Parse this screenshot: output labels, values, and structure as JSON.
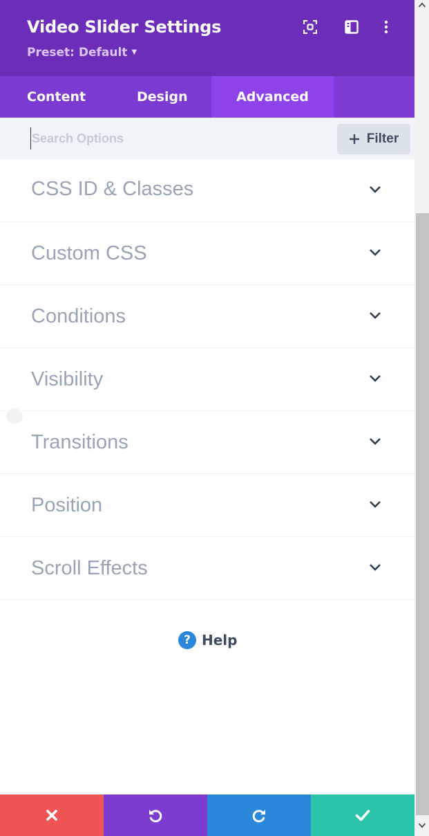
{
  "header": {
    "title": "Video Slider Settings",
    "preset": "Preset: Default",
    "icons": [
      "screenshot-mode-icon",
      "sidebar-layout-icon",
      "more-options-icon"
    ]
  },
  "tabs": [
    {
      "label": "Content",
      "active": false
    },
    {
      "label": "Design",
      "active": false
    },
    {
      "label": "Advanced",
      "active": true
    }
  ],
  "search": {
    "placeholder": "Search Options",
    "value": "",
    "filter_label": "Filter"
  },
  "sections": [
    {
      "label": "CSS ID & Classes"
    },
    {
      "label": "Custom CSS"
    },
    {
      "label": "Conditions"
    },
    {
      "label": "Visibility"
    },
    {
      "label": "Transitions"
    },
    {
      "label": "Position"
    },
    {
      "label": "Scroll Effects"
    }
  ],
  "help": {
    "label": "Help",
    "icon": "question-icon"
  },
  "footer": {
    "buttons": [
      {
        "name": "discard",
        "icon": "close-icon",
        "color": "#ef5555"
      },
      {
        "name": "undo",
        "icon": "undo-icon",
        "color": "#7e3bd0"
      },
      {
        "name": "redo",
        "icon": "redo-icon",
        "color": "#2b87da"
      },
      {
        "name": "save",
        "icon": "check-icon",
        "color": "#29c4a9"
      }
    ]
  },
  "colors": {
    "header_bg": "#6c2eb9",
    "tabs_bg": "#7b3ad1",
    "active_tab_bg": "#8e42ea",
    "section_text": "#98a4b6"
  }
}
